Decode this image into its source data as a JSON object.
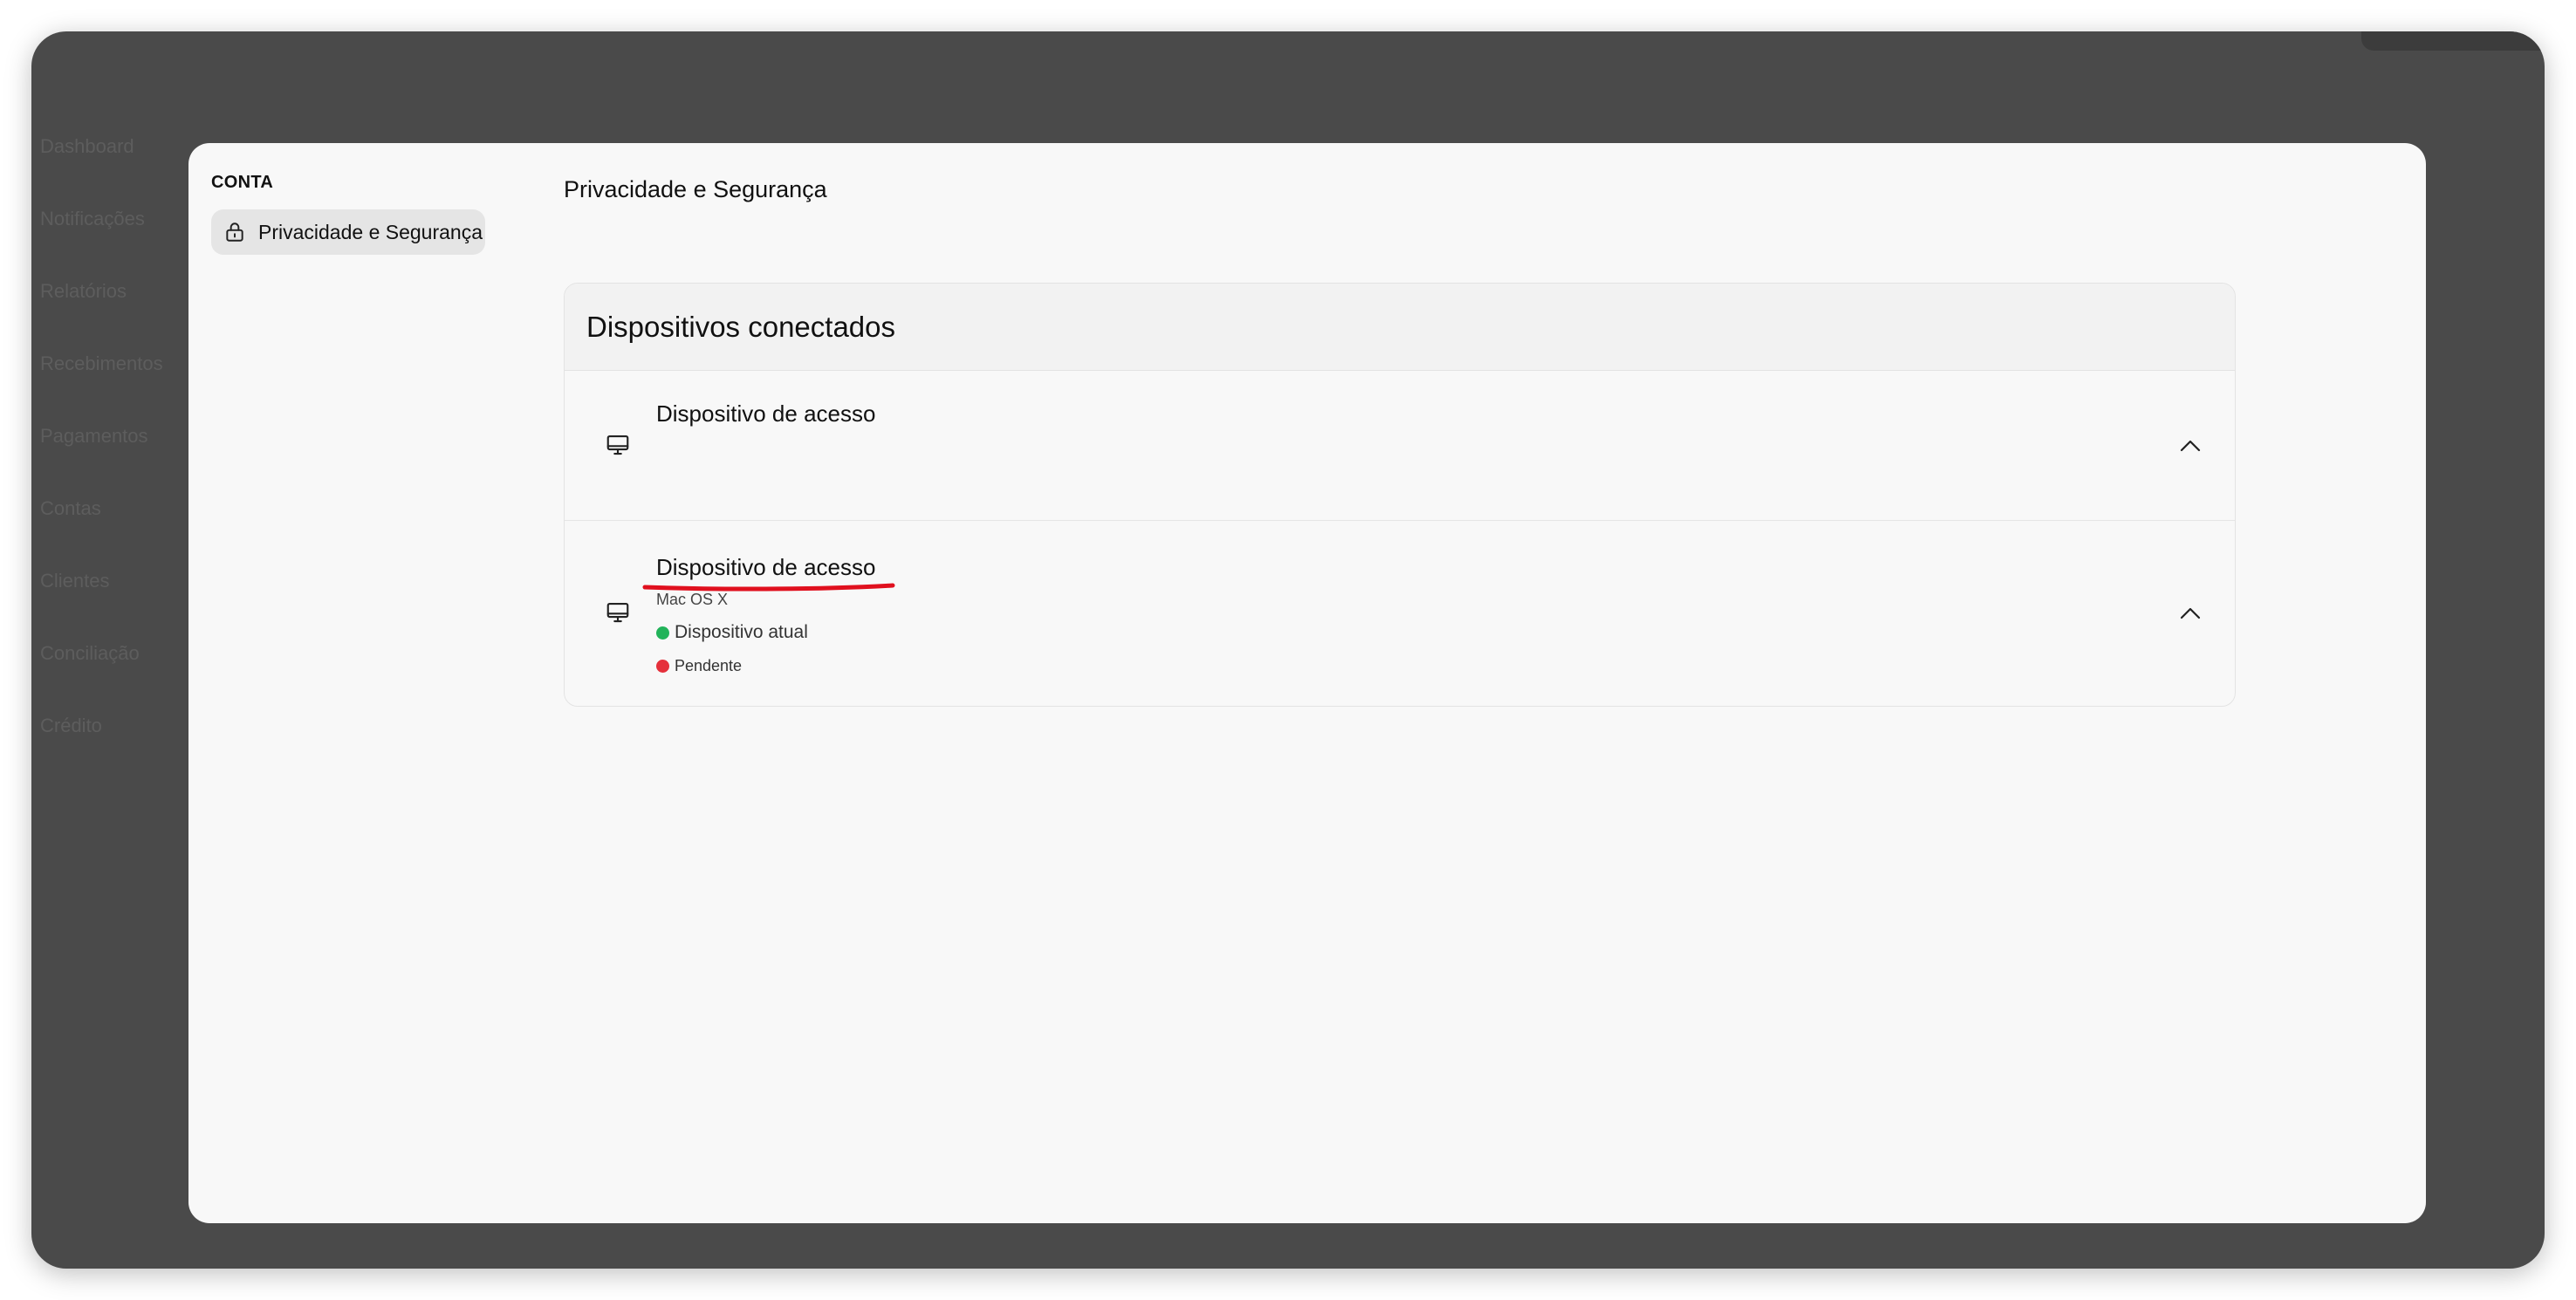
{
  "background": {
    "nav_items": [
      "Dashboard",
      "Notificações",
      "Relatórios",
      "Recebimentos",
      "Pagamentos",
      "Contas",
      "Clientes",
      "Conciliação",
      "Crédito"
    ]
  },
  "sidebar": {
    "section_label": "CONTA",
    "items": [
      {
        "label": "Privacidade e Segurança",
        "icon": "lock-icon",
        "active": true
      }
    ]
  },
  "main": {
    "title": "Privacidade e Segurança",
    "card": {
      "title": "Dispositivos conectados",
      "devices": [
        {
          "name": "Dispositivo de acesso",
          "icon": "monitor-icon",
          "expanded": true
        },
        {
          "name": "Dispositivo de acesso",
          "os": "Mac OS X",
          "icon": "monitor-icon",
          "expanded": true,
          "statuses": [
            {
              "label": "Dispositivo atual",
              "color": "#22b35a"
            },
            {
              "label": "Pendente",
              "color": "#e5303b"
            }
          ]
        }
      ]
    }
  },
  "colors": {
    "overlay": "#4a4a4a",
    "modal_bg": "#f8f8f8",
    "active_item_bg": "#e5e5e5",
    "annotation_red": "#e0101e"
  }
}
